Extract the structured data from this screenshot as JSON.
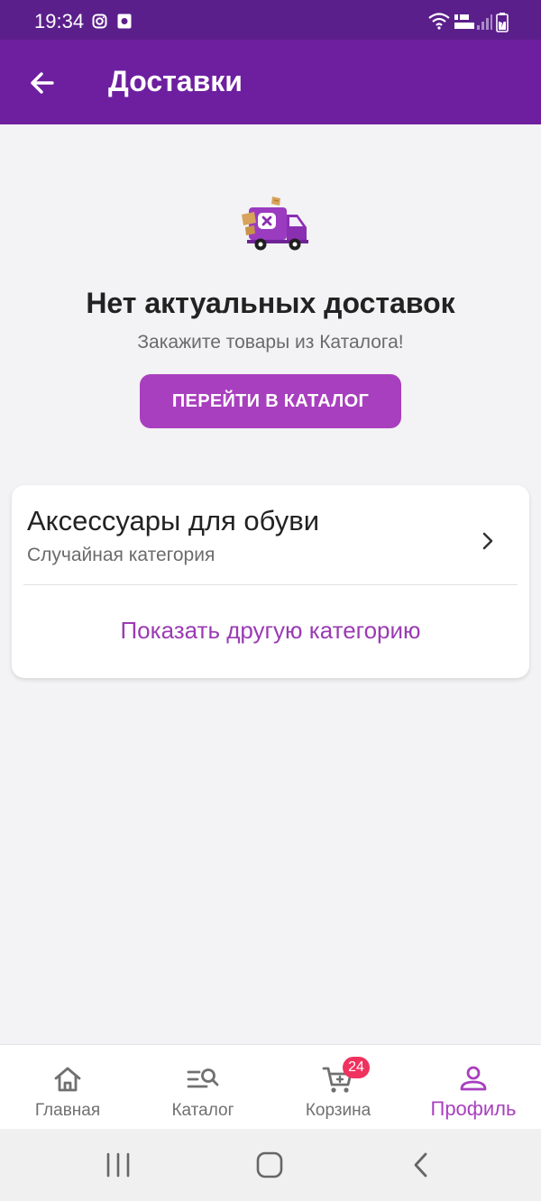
{
  "status_bar": {
    "time": "19:34",
    "icons": [
      "instagram-icon",
      "media-app-icon",
      "wifi-icon",
      "volte-lte-icon",
      "signal-icon",
      "battery-icon"
    ]
  },
  "app_bar": {
    "back_icon": "arrow-back-icon",
    "title": "Доставки",
    "color": "#6e1fa0"
  },
  "empty_state": {
    "illustration": "delivery-truck-icon",
    "title": "Нет актуальных доставок",
    "subtitle": "Закажите товары из Каталога!",
    "button_label": "ПЕРЕЙТИ В КАТАЛОГ",
    "button_color": "#a83fbe"
  },
  "category_card": {
    "title": "Аксессуары для обуви",
    "subtitle": "Случайная категория",
    "chevron_icon": "chevron-right-icon",
    "action_label": "Показать другую категорию"
  },
  "bottom_nav": {
    "items": [
      {
        "label": "Главная",
        "icon": "home-icon",
        "active": false
      },
      {
        "label": "Каталог",
        "icon": "catalog-search-icon",
        "active": false
      },
      {
        "label": "Корзина",
        "icon": "cart-icon",
        "active": false,
        "badge": "24"
      },
      {
        "label": "Профиль",
        "icon": "profile-icon",
        "active": true
      }
    ],
    "active_color": "#a83fbe",
    "badge_color": "#f0325f"
  },
  "system_nav": {
    "buttons": [
      "recents-icon",
      "home-circle-icon",
      "back-chevron-icon"
    ]
  }
}
